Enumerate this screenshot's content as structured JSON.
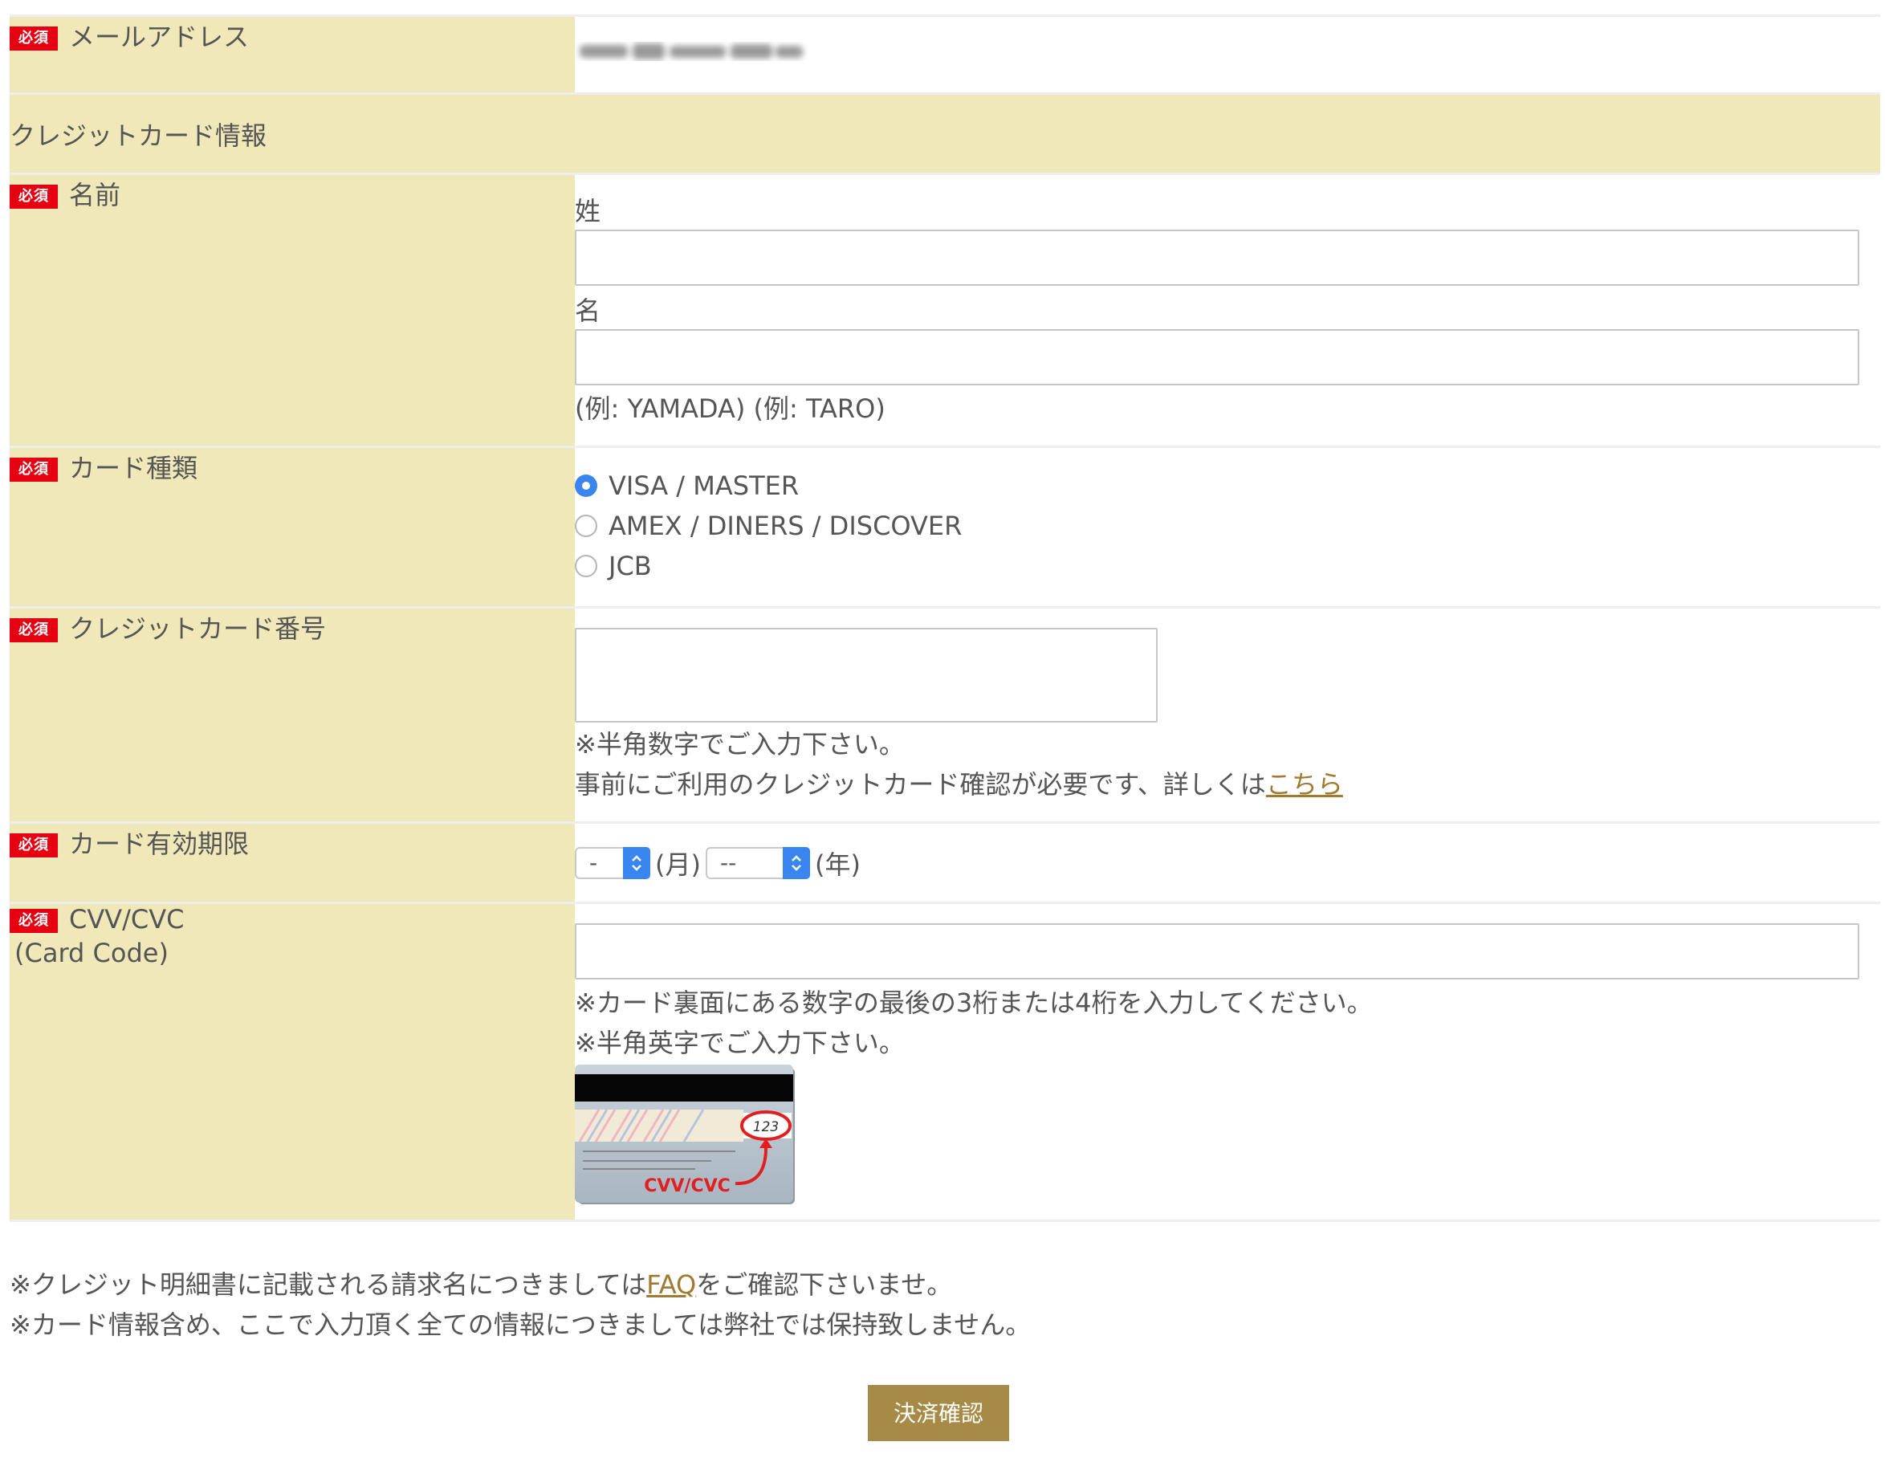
{
  "required_badge": "必須",
  "email": {
    "label": "メールアドレス",
    "value": "",
    "blurred_image": "blurred-email-image"
  },
  "section_title": "クレジットカード情報",
  "name": {
    "label": "名前",
    "last_name_caption": "姓",
    "first_name_caption": "名",
    "last_name_value": "",
    "first_name_value": "",
    "example": "(例: YAMADA) (例: TARO)"
  },
  "card_type": {
    "label": "カード種類",
    "options": [
      "VISA / MASTER",
      "AMEX / DINERS / DISCOVER",
      "JCB"
    ],
    "selected": "VISA / MASTER"
  },
  "card_number": {
    "label": "クレジットカード番号",
    "value": "",
    "note1": "※半角数字でご入力下さい。",
    "note2_prefix": "事前にご利用のクレジットカード確認が必要です、詳しくは",
    "note2_link": "こちら"
  },
  "expiry": {
    "label": "カード有効期限",
    "month_value": "-",
    "month_unit": "(月)",
    "year_value": "--",
    "year_unit": "(年)"
  },
  "cvv": {
    "label": "CVV/CVC",
    "label_sub": "(Card Code)",
    "value": "",
    "note1": "※カード裏面にある数字の最後の3桁または4桁を入力してください。",
    "note2": "※半角英字でご入力下さい。",
    "image": {
      "digits": "123",
      "caption": "CVV/CVC"
    }
  },
  "footer": {
    "line1_prefix": "※クレジット明細書に記載される請求名につきましては",
    "line1_link": "FAQ",
    "line1_suffix": "をご確認下さいませ。",
    "line2": "※カード情報含め、ここで入力頂く全ての情報につきましては弊社では保持致しません。"
  },
  "submit_label": "決済確認",
  "colors": {
    "label_bg": "#f0e8b8",
    "required_badge": "#e60012",
    "link": "#a07a30",
    "submit_bg": "#a78a46",
    "radio_selected": "#3a86f0"
  }
}
